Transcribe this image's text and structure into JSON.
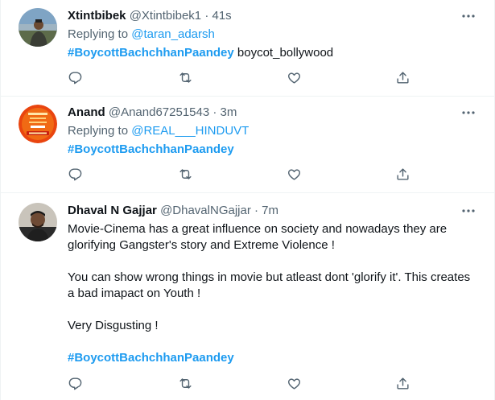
{
  "tweets": [
    {
      "name": "Xtintbibek",
      "handle": "@Xtintbibek1",
      "time": "· 41s",
      "replying_prefix": "Replying to ",
      "replying_to": "@taran_adarsh",
      "hashtag": "#BoycottBachchhanPaandey",
      "text_after_hashtag": " boycot_bollywood"
    },
    {
      "name": "Anand",
      "handle": "@Anand67251543",
      "time": "· 3m",
      "replying_prefix": "Replying to ",
      "replying_to": "@REAL___HINDUVT",
      "hashtag": "#BoycottBachchhanPaandey"
    },
    {
      "name": "Dhaval N Gajjar",
      "handle": "@DhavalNGajjar",
      "time": "· 7m",
      "paragraphs": [
        "Movie-Cinema has a great influence on society and nowadays they are glorifying Gangster's story and Extreme Violence !",
        "You can show wrong things in movie  but atleast dont 'glorify it'. This creates a bad imapact on Youth !",
        "Very Disgusting !"
      ],
      "hashtag": "#BoycottBachchhanPaandey"
    }
  ],
  "colors": {
    "accent": "#1d9bf0",
    "muted": "#536471",
    "text": "#0f1419",
    "divider": "#eff3f4"
  },
  "icons": [
    "more-icon",
    "reply-icon",
    "retweet-icon",
    "like-icon",
    "share-icon"
  ]
}
